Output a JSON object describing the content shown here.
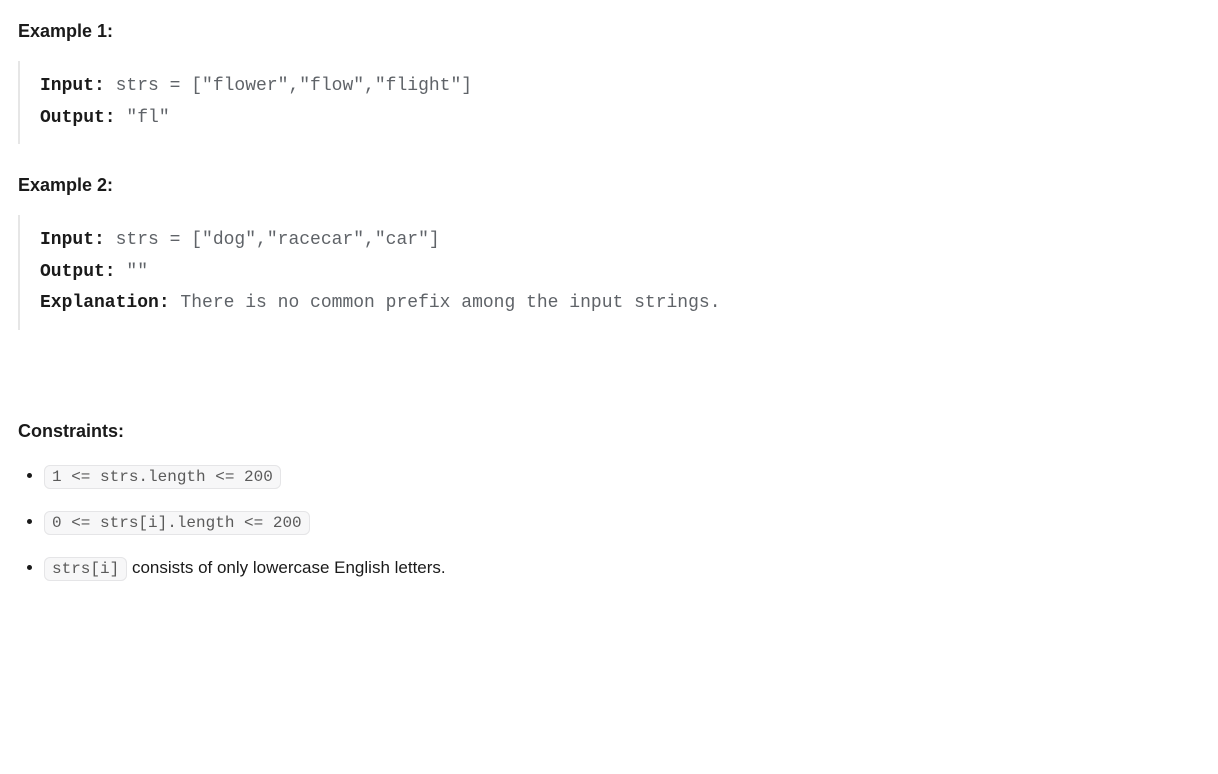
{
  "example1": {
    "heading": "Example 1:",
    "input_label": "Input:",
    "input_value": " strs = [\"flower\",\"flow\",\"flight\"]",
    "output_label": "Output:",
    "output_value": " \"fl\""
  },
  "example2": {
    "heading": "Example 2:",
    "input_label": "Input:",
    "input_value": " strs = [\"dog\",\"racecar\",\"car\"]",
    "output_label": "Output:",
    "output_value": " \"\"",
    "explanation_label": "Explanation:",
    "explanation_value": " There is no common prefix among the input strings."
  },
  "constraints": {
    "heading": "Constraints:",
    "item1_code": "1 <= strs.length <= 200",
    "item2_code": "0 <= strs[i].length <= 200",
    "item3_code": "strs[i]",
    "item3_text": " consists of only lowercase English letters."
  }
}
